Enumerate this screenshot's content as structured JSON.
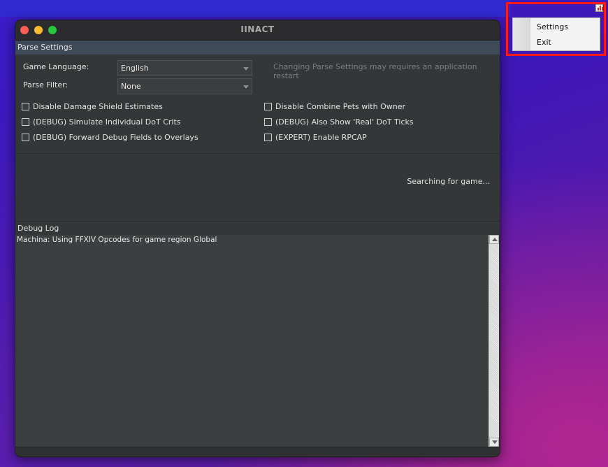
{
  "window": {
    "title": "IINACT"
  },
  "parse_settings": {
    "heading": "Parse Settings",
    "game_language_label": "Game Language:",
    "game_language_value": "English",
    "parse_filter_label": "Parse Filter:",
    "parse_filter_value": "None",
    "restart_hint": "Changing Parse Settings may requires an application restart",
    "checkboxes": [
      {
        "label": "Disable Damage Shield Estimates",
        "checked": false
      },
      {
        "label": "(DEBUG) Simulate Individual DoT Crits",
        "checked": false
      },
      {
        "label": "(DEBUG) Forward Debug Fields to Overlays",
        "checked": false
      },
      {
        "label": "Disable Combine Pets with Owner",
        "checked": false
      },
      {
        "label": "(DEBUG) Also Show 'Real' DoT Ticks",
        "checked": false
      },
      {
        "label": "(EXPERT) Enable RPCAP",
        "checked": false
      }
    ]
  },
  "status": {
    "text": "Searching for game..."
  },
  "debug_log": {
    "heading": "Debug Log",
    "lines": [
      "Machina: Using FFXIV Opcodes for game region Global"
    ]
  },
  "tray_menu": {
    "items": [
      "Settings",
      "Exit"
    ],
    "highlight_color": "#ff1a1a"
  }
}
